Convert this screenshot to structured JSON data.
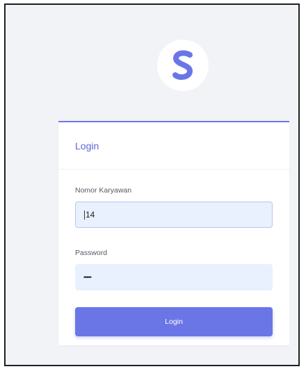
{
  "brand": {
    "logo_icon": "s-brand-logo-icon",
    "color": "#6b76e6"
  },
  "login_card": {
    "title": "Login",
    "employee_number": {
      "label": "Nomor Karyawan",
      "value": "14"
    },
    "password": {
      "label": "Password",
      "value": "•••••"
    },
    "submit_label": "Login"
  }
}
